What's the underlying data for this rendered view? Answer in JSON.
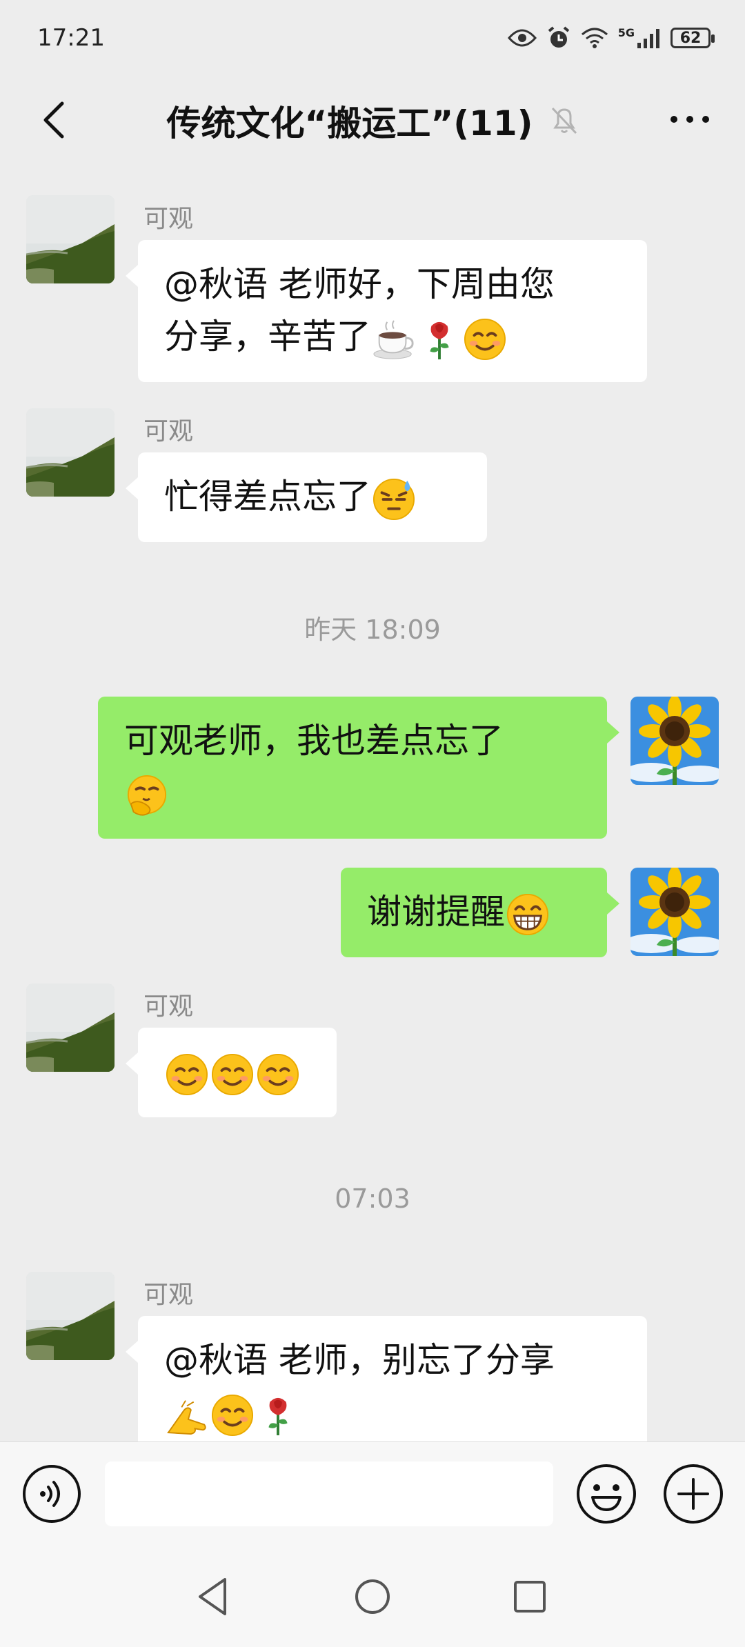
{
  "status_bar": {
    "time": "17:21",
    "network": "5G",
    "battery": "62"
  },
  "header": {
    "title": "传统文化“搬运工”(11)"
  },
  "messages": [
    {
      "sender": "可观",
      "text": "@秋语  老师好，下周由您",
      "text2": "分享，辛苦了"
    },
    {
      "sender": "可观",
      "text": "忙得差点忘了"
    },
    {
      "timestamp": "昨天 18:09"
    },
    {
      "text": "可观老师，我也差点忘了"
    },
    {
      "text": "谢谢提醒"
    },
    {
      "sender": "可观"
    },
    {
      "timestamp": "07:03"
    },
    {
      "sender": "可观",
      "text": "@秋语  老师，别忘了分享"
    }
  ],
  "colors": {
    "sent_bubble": "#95ec69",
    "received_bubble": "#ffffff",
    "background": "#ededed"
  }
}
